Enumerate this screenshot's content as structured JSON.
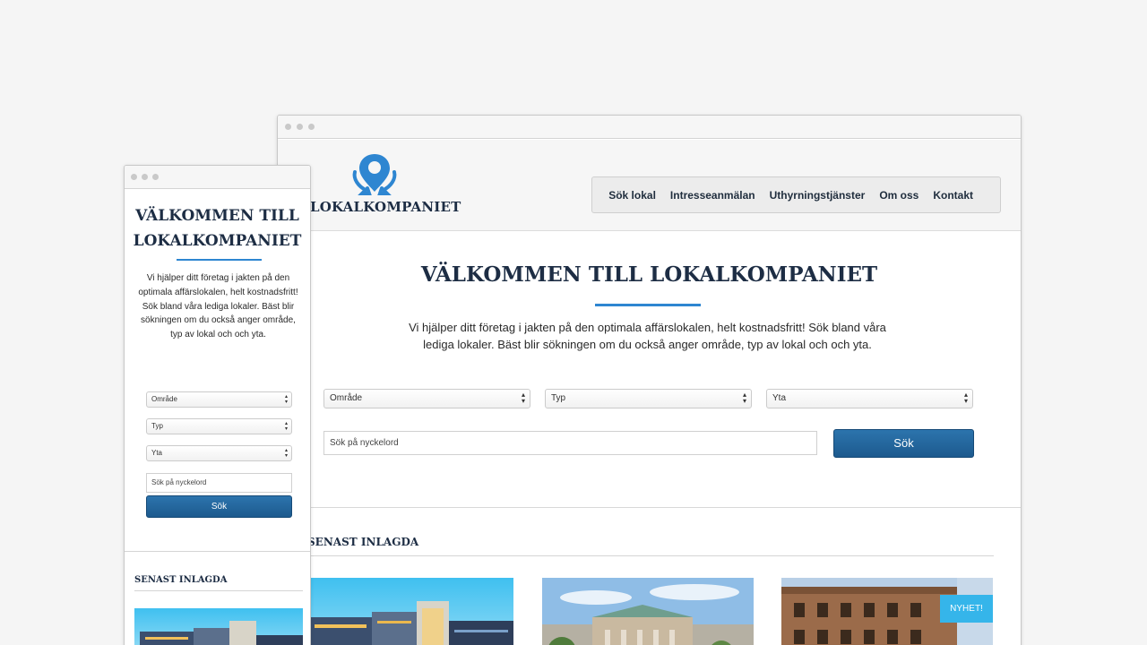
{
  "brand": {
    "name": "LOKALKOMPANIET",
    "accent": "#2e86d1",
    "navy": "#1d2d44",
    "button_color": "#1f5f94",
    "badge_color": "#35b5ea"
  },
  "nav": {
    "items": [
      "Sök lokal",
      "Intresseanmälan",
      "Uthyrningstjänster",
      "Om oss",
      "Kontakt"
    ]
  },
  "hero": {
    "title": "VÄLKOMMEN TILL LOKALKOMPANIET",
    "text": "Vi hjälper ditt företag i jakten på den optimala affärslokalen, helt kostnadsfritt! Sök bland våra lediga lokaler. Bäst blir sökningen om du också anger område, typ av lokal och och yta."
  },
  "search": {
    "area_select": "Område",
    "type_select": "Typ",
    "size_select": "Yta",
    "keyword_placeholder": "Sök på nyckelord",
    "submit_label": "Sök"
  },
  "latest": {
    "title": "SENAST INLAGDA",
    "badge": "NYHET!",
    "listing_images": [
      "modern-office-building",
      "classical-building-city-square",
      "brick-facade-building"
    ]
  },
  "mobile": {
    "title": "VÄLKOMMEN TILL LOKALKOMPANIET",
    "text": "Vi hjälper ditt företag i jakten på den optimala affärslokalen, helt kostnadsfritt! Sök bland våra lediga lokaler. Bäst blir sökningen om du också anger område, typ av lokal och och yta.",
    "area_select": "Område",
    "type_select": "Typ",
    "size_select": "Yta",
    "keyword_placeholder": "Sök på nyckelord",
    "submit_label": "Sök",
    "latest_title": "SENAST INLAGDA"
  }
}
